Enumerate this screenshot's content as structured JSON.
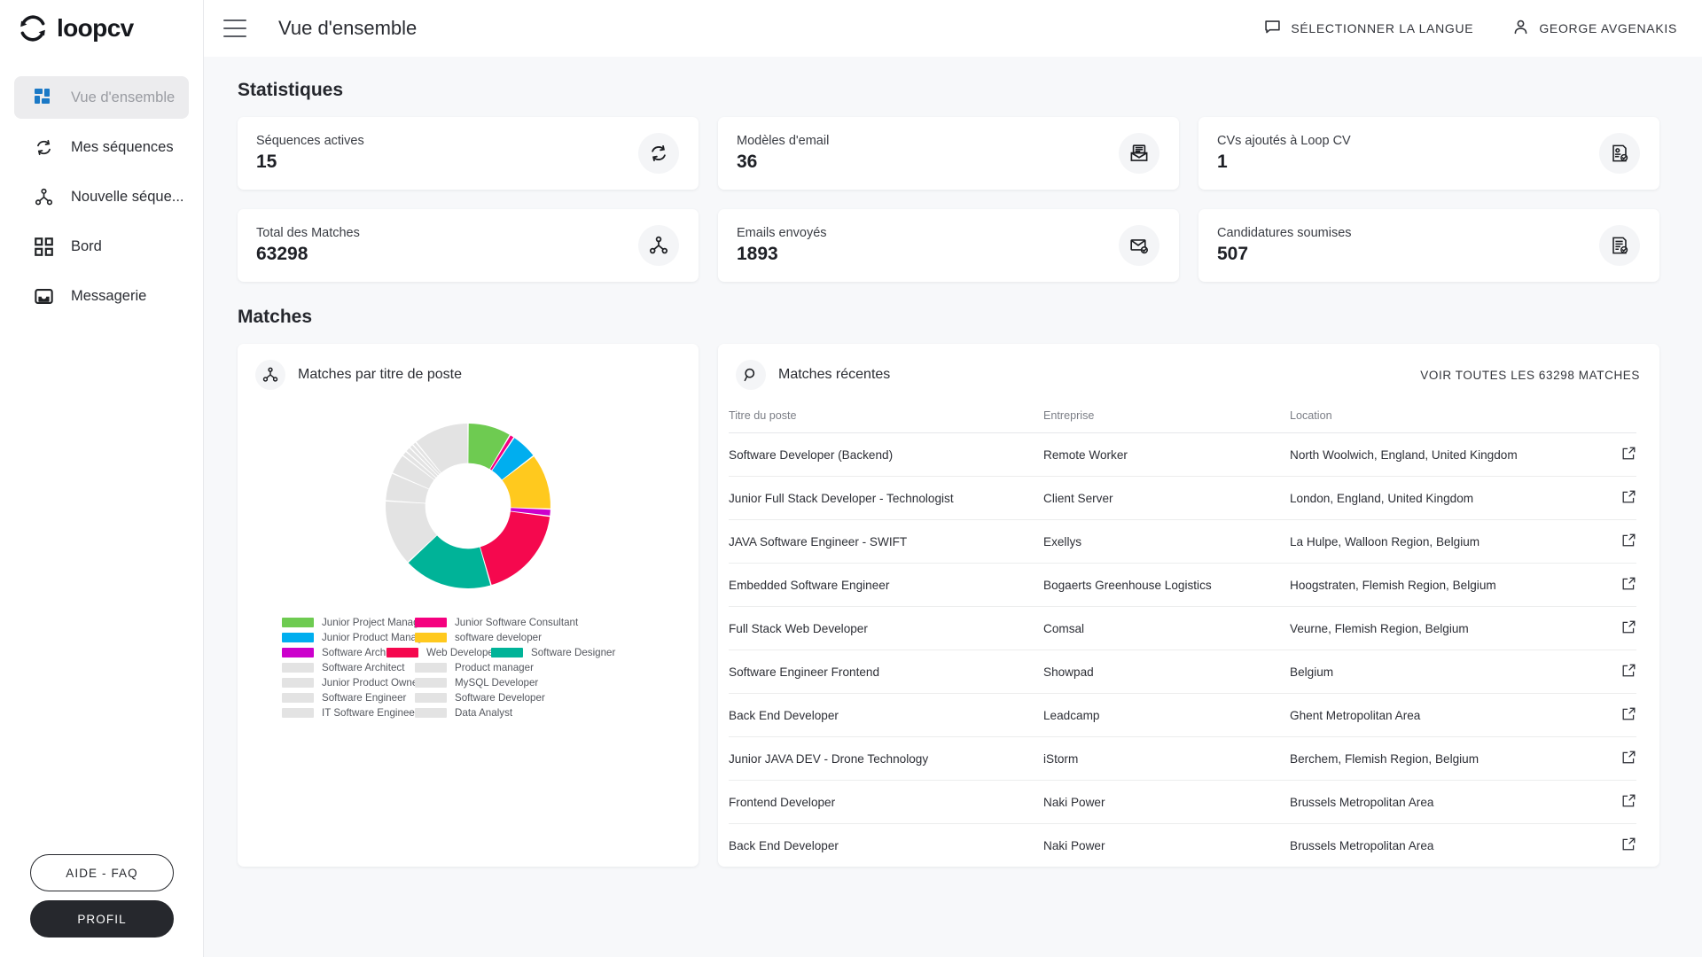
{
  "brand": {
    "name": "loopcv",
    "logo_icon": "loop-refresh-logo"
  },
  "sidebar": {
    "items": [
      {
        "label": "Vue d'ensemble",
        "icon": "dashboard-grid-icon",
        "active": true
      },
      {
        "label": "Mes séquences",
        "icon": "refresh-icon",
        "active": false
      },
      {
        "label": "Nouvelle séque...",
        "icon": "share-nodes-icon",
        "active": false
      },
      {
        "label": "Bord",
        "icon": "grid-squares-icon",
        "active": false
      },
      {
        "label": "Messagerie",
        "icon": "inbox-icon",
        "active": false
      }
    ],
    "faq_label": "AIDE - FAQ",
    "profile_label": "PROFIL"
  },
  "header": {
    "menu_icon": "hamburger-icon",
    "title": "Vue d'ensemble",
    "language_label": "SÉLECTIONNER LA LANGUE",
    "language_icon": "chat-bubble-icon",
    "user_label": "GEORGE AVGENAKIS",
    "user_icon": "person-icon"
  },
  "main": {
    "statistics_title": "Statistiques",
    "matches_title": "Matches",
    "stats": [
      {
        "label": "Séquences actives",
        "value": "15",
        "icon": "refresh-icon"
      },
      {
        "label": "Modèles d'email",
        "value": "36",
        "icon": "mail-open-icon"
      },
      {
        "label": "CVs ajoutés à Loop CV",
        "value": "1",
        "icon": "cv-check-icon"
      },
      {
        "label": "Total des Matches",
        "value": "63298",
        "icon": "share-nodes-icon"
      },
      {
        "label": "Emails envoyés",
        "value": "1893",
        "icon": "mail-check-icon"
      },
      {
        "label": "Candidatures soumises",
        "value": "507",
        "icon": "document-check-icon"
      }
    ],
    "chart_panel": {
      "title": "Matches par titre de poste",
      "icon": "share-nodes-icon"
    },
    "table_panel": {
      "title": "Matches récentes",
      "icon": "search-icon",
      "view_all_label": "VOIR TOUTES LES 63298 MATCHES",
      "columns": [
        "Titre du poste",
        "Entreprise",
        "Location"
      ],
      "action_icon": "external-link-icon",
      "rows": [
        {
          "title": "Software Developer (Backend)",
          "company": "Remote Worker",
          "location": "North Woolwich, England, United Kingdom"
        },
        {
          "title": "Junior Full Stack Developer - Technologist",
          "company": "Client Server",
          "location": "London, England, United Kingdom"
        },
        {
          "title": "JAVA Software Engineer - SWIFT",
          "company": "Exellys",
          "location": "La Hulpe, Walloon Region, Belgium"
        },
        {
          "title": "Embedded Software Engineer",
          "company": "Bogaerts Greenhouse Logistics",
          "location": "Hoogstraten, Flemish Region, Belgium"
        },
        {
          "title": "Full Stack Web Developer",
          "company": "Comsal",
          "location": "Veurne, Flemish Region, Belgium"
        },
        {
          "title": "Software Engineer Frontend",
          "company": "Showpad",
          "location": "Belgium"
        },
        {
          "title": "Back End Developer",
          "company": "Leadcamp",
          "location": "Ghent Metropolitan Area"
        },
        {
          "title": "Junior JAVA DEV - Drone Technology",
          "company": "iStorm",
          "location": "Berchem, Flemish Region, Belgium"
        },
        {
          "title": "Frontend Developer",
          "company": "Naki Power",
          "location": "Brussels Metropolitan Area"
        },
        {
          "title": "Back End Developer",
          "company": "Naki Power",
          "location": "Brussels Metropolitan Area"
        }
      ]
    }
  },
  "chart_data": {
    "type": "pie",
    "title": "Matches par titre de poste",
    "legend_position": "bottom",
    "donut": true,
    "inner_radius_ratio": 0.52,
    "categories": [
      "Junior Project Manager",
      "Junior Software Consultant",
      "Junior Product Manager",
      "software developer",
      "Software Architect",
      "Web Developer",
      "Software Designer",
      "Software Architect",
      "Product manager",
      "Junior Product Owner",
      "MySQL Developer",
      "Software Engineer",
      "Software Developer",
      "IT Software Engineer",
      "Data Analyst"
    ],
    "values": [
      8.5,
      0.9,
      5.2,
      11.0,
      1.4,
      18.5,
      17.5,
      13.0,
      5.5,
      4.0,
      1.0,
      1.0,
      0.8,
      0.8,
      10.9
    ],
    "colors": [
      "#6ECB51",
      "#F5007F",
      "#00AEEF",
      "#FFC91E",
      "#CC00CC",
      "#F5084E",
      "#00B398",
      "#E3E3E3",
      "#E3E3E3",
      "#E3E3E3",
      "#E3E3E3",
      "#E3E3E3",
      "#E3E3E3",
      "#E3E3E3",
      "#E3E3E3"
    ],
    "legend": [
      {
        "label": "Junior Project Manager",
        "color": "#6ECB51"
      },
      {
        "label": "Junior Software Consultant",
        "color": "#F5007F"
      },
      {
        "label": "Junior Product Manager",
        "color": "#00AEEF"
      },
      {
        "label": "software developer",
        "color": "#FFC91E"
      },
      {
        "label": "Software Architect",
        "color": "#CC00CC"
      },
      {
        "label": "Web Developer",
        "color": "#F5084E"
      },
      {
        "label": "Software Designer",
        "color": "#00B398"
      },
      {
        "label": "Software Architect",
        "color": "#E3E3E3"
      },
      {
        "label": "Product manager",
        "color": "#E3E3E3"
      },
      {
        "label": "Junior Product Owner",
        "color": "#E3E3E3"
      },
      {
        "label": "MySQL Developer",
        "color": "#E3E3E3"
      },
      {
        "label": "Software Engineer",
        "color": "#E3E3E3"
      },
      {
        "label": "Software Developer",
        "color": "#E3E3E3"
      },
      {
        "label": "IT Software Engineer",
        "color": "#E3E3E3"
      },
      {
        "label": "Data Analyst",
        "color": "#E3E3E3"
      }
    ]
  }
}
